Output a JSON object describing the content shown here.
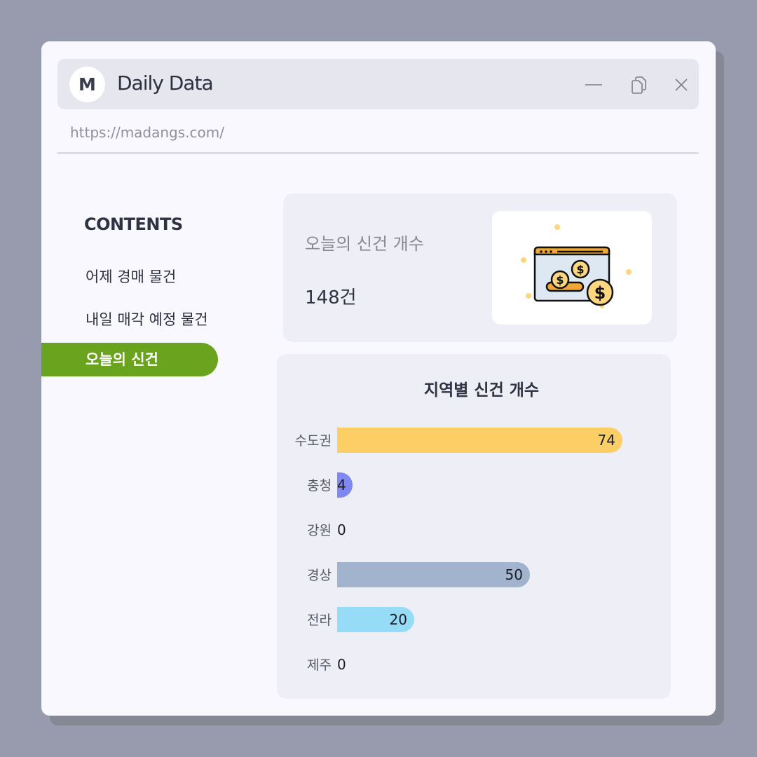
{
  "app": {
    "logo_letter": "M",
    "title": "Daily Data",
    "url": "https://madangs.com/"
  },
  "window_controls": {
    "minimize_icon": "minimize-icon",
    "restore_icon": "restore-icon",
    "close_icon": "close-icon"
  },
  "sidebar": {
    "heading": "CONTENTS",
    "items": [
      {
        "label": "어제 경매 물건",
        "active": false
      },
      {
        "label": "내일 매각 예정 물건",
        "active": false
      },
      {
        "label": "오늘의 신건",
        "active": true
      }
    ],
    "active_color": "#6aa41f"
  },
  "summary_card": {
    "label": "오늘의 신건 개수",
    "value": "148건",
    "icon": "money-browser-icon"
  },
  "chart_data": {
    "type": "bar",
    "orientation": "horizontal",
    "title": "지역별 신건 개수",
    "categories": [
      "수도권",
      "충청",
      "강원",
      "경상",
      "전라",
      "제주"
    ],
    "values": [
      74,
      4,
      0,
      50,
      20,
      0
    ],
    "colors": [
      "#fccf65",
      "#7f88f3",
      "#c8c8c8",
      "#a2b3ce",
      "#97dcf7",
      "#c8c8c8"
    ],
    "xlim": [
      0,
      100
    ],
    "grid": false,
    "legend": false
  }
}
